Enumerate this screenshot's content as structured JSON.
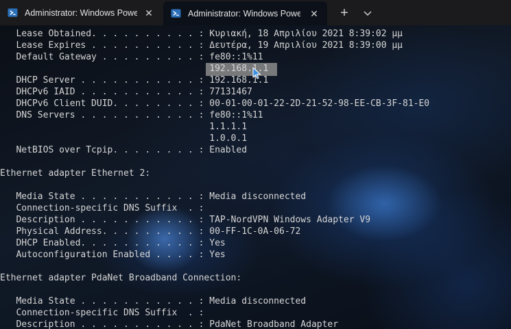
{
  "tabs": [
    {
      "label": "Administrator: Windows PowerShell",
      "icon": "powershell-icon",
      "active": false
    },
    {
      "label": "Administrator: Windows PowerShell",
      "icon": "powershell-icon",
      "active": true
    }
  ],
  "tabbar": {
    "close_glyph": "✕",
    "new_tab_glyph": "+",
    "dropdown_icon": "chevron-down-icon"
  },
  "terminal": {
    "lines": [
      "   Lease Obtained. . . . . . . . . . : Κυριακή, 18 Απριλίου 2021 8:39:02 μμ",
      "   Lease Expires . . . . . . . . . . : Δευτέρα, 19 Απριλίου 2021 8:39:00 μμ",
      "   Default Gateway . . . . . . . . . : fe80::1%11",
      "                                       192.168.1.1",
      "   DHCP Server . . . . . . . . . . . : 192.168.1.1",
      "   DHCPv6 IAID . . . . . . . . . . . : 77131467",
      "   DHCPv6 Client DUID. . . . . . . . : 00-01-00-01-22-2D-21-52-98-EE-CB-3F-81-E0",
      "   DNS Servers . . . . . . . . . . . : fe80::1%11",
      "                                       1.1.1.1",
      "                                       1.0.0.1",
      "   NetBIOS over Tcpip. . . . . . . . : Enabled",
      "",
      "Ethernet adapter Ethernet 2:",
      "",
      "   Media State . . . . . . . . . . . : Media disconnected",
      "   Connection-specific DNS Suffix  . :",
      "   Description . . . . . . . . . . . : TAP-NordVPN Windows Adapter V9",
      "   Physical Address. . . . . . . . . : 00-FF-1C-0A-06-72",
      "   DHCP Enabled. . . . . . . . . . . : Yes",
      "   Autoconfiguration Enabled . . . . : Yes",
      "",
      "Ethernet adapter PdaNet Broadband Connection:",
      "",
      "   Media State . . . . . . . . . . . : Media disconnected",
      "   Connection-specific DNS Suffix  . :",
      "   Description . . . . . . . . . . . : PdaNet Broadband Adapter"
    ]
  },
  "colors": {
    "text": "#d6d6d6",
    "tabbar": "#1b1b1d",
    "terminal_bg": "#0c1119",
    "selection": "#8b8b8b"
  }
}
